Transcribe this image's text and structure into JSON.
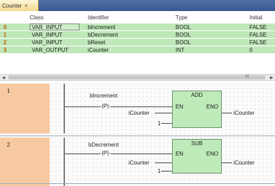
{
  "tab": {
    "label": "Counter",
    "close": "×"
  },
  "table": {
    "headers": {
      "class": "Class",
      "identifier": "Identifier",
      "type": "Type",
      "initial": "Initial"
    },
    "rows": [
      {
        "num": "0",
        "class": "VAR_INPUT",
        "identifier": "bIncrement",
        "type": "BOOL",
        "initial": "FALSE"
      },
      {
        "num": "1",
        "class": "VAR_INPUT",
        "identifier": "bDecrement",
        "type": "BOOL",
        "initial": "FALSE"
      },
      {
        "num": "2",
        "class": "VAR_INPUT",
        "identifier": "bReset",
        "type": "BOOL",
        "initial": "FALSE"
      },
      {
        "num": "3",
        "class": "VAR_OUTPUT",
        "identifier": "iCounter",
        "type": "INT",
        "initial": "0"
      }
    ],
    "scroll_grip": "III"
  },
  "networks": [
    {
      "number": "1",
      "contact_label": "bIncrement",
      "contact_mark": "-|P|-",
      "block_name": "ADD",
      "en": "EN",
      "eno": "ENO",
      "in1": "iCounter",
      "in2": "1",
      "output": "iCounter"
    },
    {
      "number": "2",
      "contact_label": "bDecrement",
      "contact_mark": "-|P|-",
      "block_name": "SUB",
      "en": "EN",
      "eno": "ENO",
      "in1": "iCounter",
      "in2": "1",
      "output": "iCounter"
    }
  ]
}
